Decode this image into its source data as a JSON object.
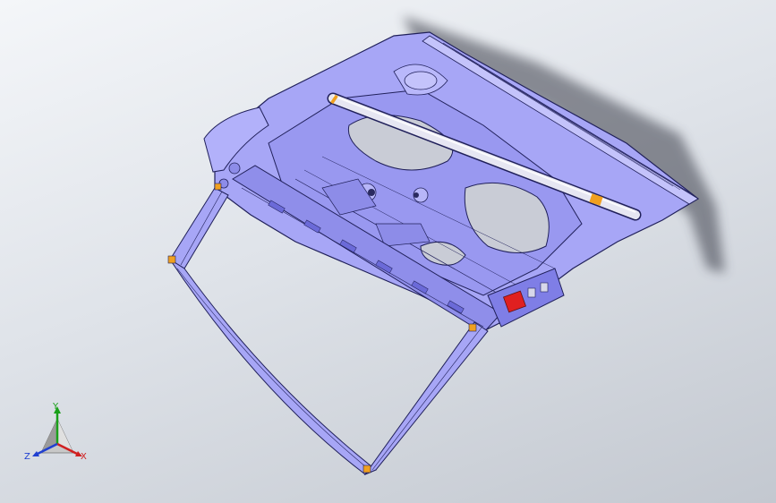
{
  "viewport": {
    "background_top": "#f4f6f9",
    "background_bottom": "#c3c8d0"
  },
  "model": {
    "body_color": "#a7a6f6",
    "body_shade": "#7f7ee6",
    "edge_color": "#20205a",
    "strut_color": "#e6e6f2",
    "marker_orange": "#f0a020",
    "marker_red": "#e02020"
  },
  "triad": {
    "x_label": "X",
    "y_label": "Y",
    "z_label": "Z",
    "x_color": "#d02020",
    "y_color": "#1aa01a",
    "z_color": "#2040d0"
  }
}
